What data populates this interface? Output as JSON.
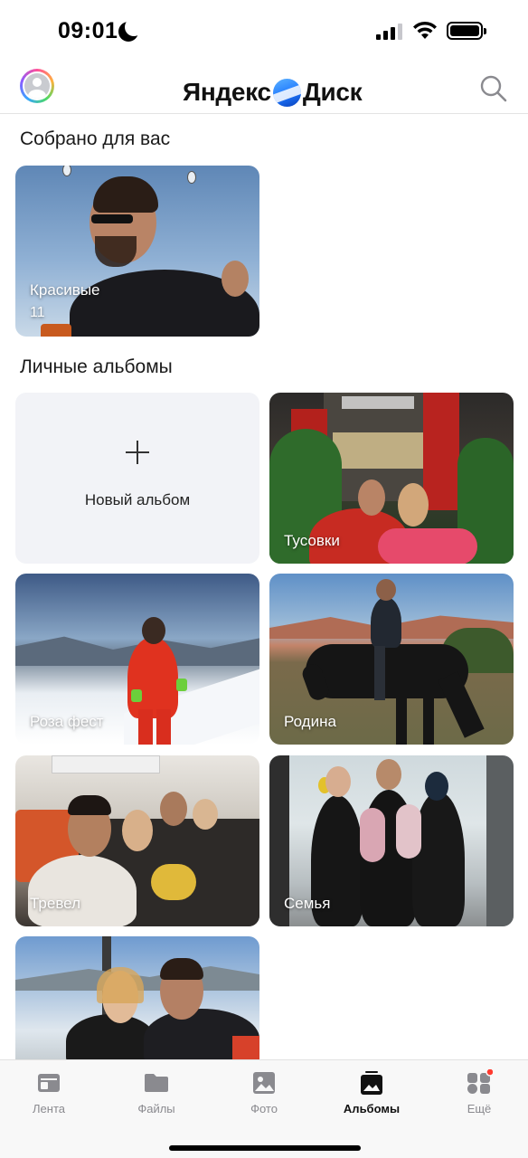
{
  "status_bar": {
    "time": "09:01"
  },
  "header": {
    "logo_left": "Яндекс",
    "logo_right": "Диск",
    "avatar_icon": "avatar-icon",
    "search_icon": "search-icon"
  },
  "collected": {
    "title": "Собрано для вас",
    "albums": [
      {
        "label": "Красивые",
        "count": "11"
      }
    ]
  },
  "personal": {
    "title": "Личные альбомы",
    "new_album_label": "Новый альбом",
    "albums": [
      {
        "label": "Тусовки"
      },
      {
        "label": "Роза фест"
      },
      {
        "label": "Родина"
      },
      {
        "label": "Тревел"
      },
      {
        "label": "Семья"
      },
      {
        "label": ""
      }
    ]
  },
  "tabbar": {
    "tabs": [
      {
        "label": "Лента",
        "icon": "feed-icon"
      },
      {
        "label": "Файлы",
        "icon": "folder-icon"
      },
      {
        "label": "Фото",
        "icon": "photo-icon"
      },
      {
        "label": "Альбомы",
        "icon": "albums-icon",
        "active": true
      },
      {
        "label": "Ещё",
        "icon": "more-icon",
        "badge": true
      }
    ]
  },
  "colors": {
    "accent": "#1e78ff",
    "badge": "#ff3b30",
    "tab_inactive": "#8a8a8f",
    "tile_bg": "#f2f3f7"
  }
}
